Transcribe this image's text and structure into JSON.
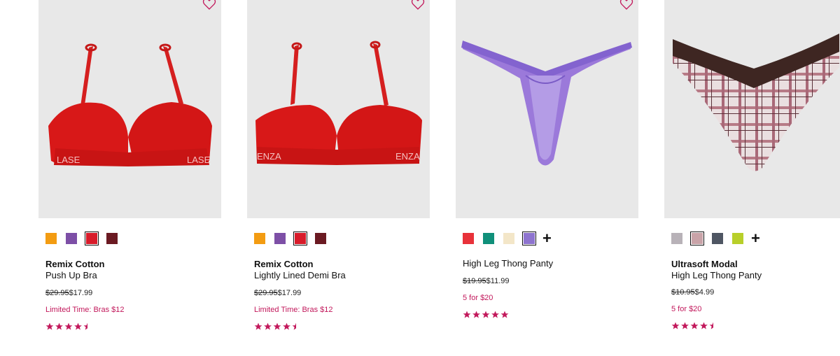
{
  "products": [
    {
      "name_bold": "Remix Cotton",
      "name": "Push Up Bra",
      "price_was": "$29.95",
      "price_now": "$17.99",
      "promo": "Limited Time: Bras $12",
      "rating": 4.5,
      "swatches": [
        {
          "color": "#f39c12",
          "selected": false
        },
        {
          "color": "#7d4fa6",
          "selected": false
        },
        {
          "color": "#d81b2a",
          "selected": true
        },
        {
          "color": "#6b1a22",
          "selected": false
        }
      ],
      "more_swatches": false
    },
    {
      "name_bold": "Remix Cotton",
      "name": "Lightly Lined Demi Bra",
      "price_was": "$29.95",
      "price_now": "$17.99",
      "promo": "Limited Time: Bras $12",
      "rating": 4.5,
      "swatches": [
        {
          "color": "#f39c12",
          "selected": false
        },
        {
          "color": "#7d4fa6",
          "selected": false
        },
        {
          "color": "#d81b2a",
          "selected": true
        },
        {
          "color": "#6b1a22",
          "selected": false
        }
      ],
      "more_swatches": false
    },
    {
      "name_bold": "",
      "name": "High Leg Thong Panty",
      "price_was": "$19.95",
      "price_now": "$11.99",
      "promo": "5 for $20",
      "rating": 5,
      "swatches": [
        {
          "color": "#e8323a",
          "selected": false
        },
        {
          "color": "#10907a",
          "selected": false
        },
        {
          "color": "#f3e6c8",
          "selected": false
        },
        {
          "color": "#8e74cf",
          "selected": true
        }
      ],
      "more_swatches": true,
      "more_label": "+"
    },
    {
      "name_bold": "Ultrasoft Modal",
      "name": "High Leg Thong Panty",
      "price_was": "$10.95",
      "price_now": "$4.99",
      "promo": "5 for $20",
      "rating": 4.5,
      "swatches": [
        {
          "color": "#b8b2b8",
          "selected": false
        },
        {
          "color": "#c9a3a8",
          "selected": true
        },
        {
          "color": "#4f5663",
          "selected": false
        },
        {
          "color": "#b8cf2a",
          "selected": false
        }
      ],
      "more_swatches": true,
      "more_label": "+"
    }
  ],
  "colors": {
    "accent": "#c2185b",
    "image_bg": "#e8e8e8"
  }
}
